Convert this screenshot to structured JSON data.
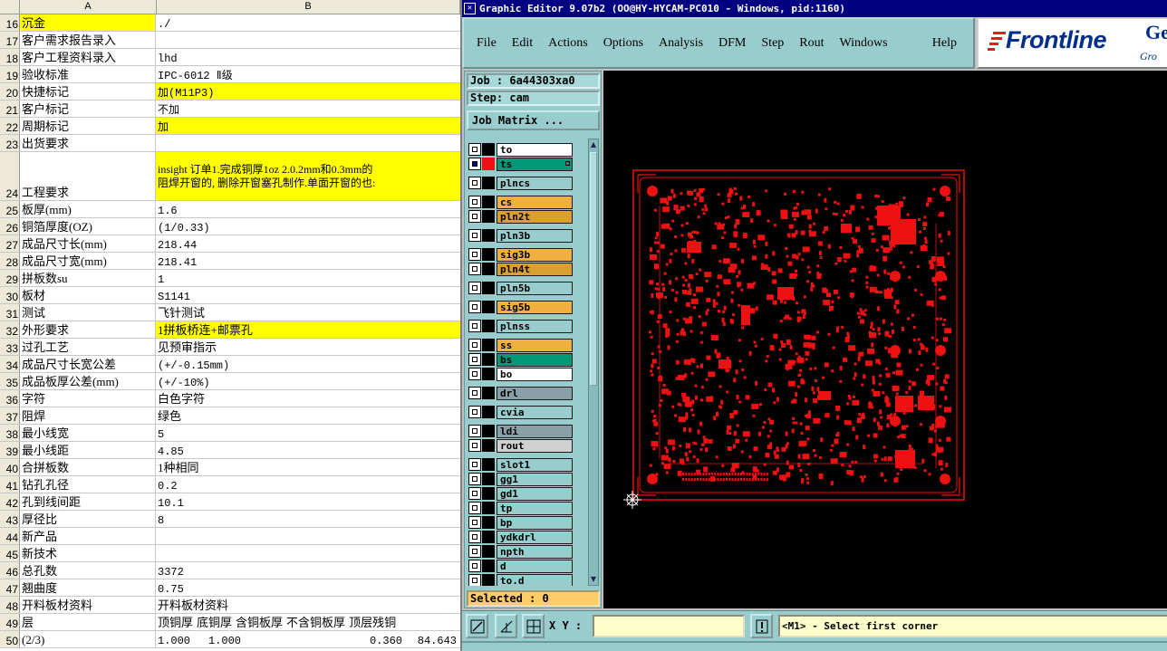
{
  "spreadsheet": {
    "columns": [
      "A",
      "B"
    ],
    "rows": [
      {
        "n": "16",
        "a": "沉金",
        "b": "./",
        "hl": "a",
        "h": 19
      },
      {
        "n": "17",
        "a": "客户需求报告录入",
        "b": "",
        "h": 19
      },
      {
        "n": "18",
        "a": "客户工程资料录入",
        "b": "lhd",
        "h": 19
      },
      {
        "n": "19",
        "a": "验收标准",
        "b": "IPC-6012 Ⅱ级",
        "h": 19
      },
      {
        "n": "20",
        "a": "快捷标记",
        "b": "加(M11P3)",
        "hl": "b",
        "h": 19
      },
      {
        "n": "21",
        "a": "客户标记",
        "b": "不加",
        "h": 19
      },
      {
        "n": "22",
        "a": "周期标记",
        "b": "加",
        "hl": "b",
        "h": 19
      },
      {
        "n": "23",
        "a": "出货要求",
        "b": "",
        "h": 19
      },
      {
        "n": "24",
        "a": "工程要求",
        "b": "insight 订单1.完成铜厚1oz 2.0.2mm和0.3mm的",
        "b2": "阻焊开窗的, 删除开窗塞孔制作.单面开窗的也:",
        "hl": "b",
        "h": 54,
        "wrap": true
      },
      {
        "n": "25",
        "a": "板厚(mm)",
        "b": "1.6",
        "h": 19
      },
      {
        "n": "26",
        "a": "铜箔厚度(OZ)",
        "b": "(1/0.33)",
        "h": 19
      },
      {
        "n": "27",
        "a": "成品尺寸长(mm)",
        "b": "218.44",
        "h": 19
      },
      {
        "n": "28",
        "a": "成品尺寸宽(mm)",
        "b": "218.41",
        "h": 19
      },
      {
        "n": "29",
        "a": "拼板数su",
        "b": "1",
        "h": 19
      },
      {
        "n": "30",
        "a": "板材",
        "b": "S1141",
        "h": 19
      },
      {
        "n": "31",
        "a": "测试",
        "b": "飞针测试",
        "prop": true,
        "h": 19
      },
      {
        "n": "32",
        "a": "外形要求",
        "b": "1拼板桥连+邮票孔",
        "hl": "b",
        "prop": true,
        "h": 19
      },
      {
        "n": "33",
        "a": "过孔工艺",
        "b": "见预审指示",
        "prop": true,
        "h": 19
      },
      {
        "n": "34",
        "a": "成品尺寸长宽公差",
        "b": "(+/-0.15mm)",
        "h": 19
      },
      {
        "n": "35",
        "a": "成品板厚公差(mm)",
        "b": "(+/-10%)",
        "h": 19
      },
      {
        "n": "36",
        "a": "字符",
        "b": "白色字符",
        "prop": true,
        "h": 19
      },
      {
        "n": "37",
        "a": "阻焊",
        "b": "绿色",
        "prop": true,
        "h": 19
      },
      {
        "n": "38",
        "a": "最小线宽",
        "b": "5",
        "h": 19
      },
      {
        "n": "39",
        "a": "最小线距",
        "b": "4.85",
        "h": 19
      },
      {
        "n": "40",
        "a": "合拼板数",
        "b": "1种相同",
        "prop": true,
        "h": 19
      },
      {
        "n": "41",
        "a": "钻孔孔径",
        "b": "0.2",
        "h": 19
      },
      {
        "n": "42",
        "a": "孔到线间距",
        "b": "10.1",
        "h": 19
      },
      {
        "n": "43",
        "a": "厚径比",
        "b": "8",
        "h": 19
      },
      {
        "n": "44",
        "a": "新产品",
        "b": "",
        "h": 19
      },
      {
        "n": "45",
        "a": "新技术",
        "b": "",
        "h": 19
      },
      {
        "n": "46",
        "a": "总孔数",
        "b": "3372",
        "h": 19
      },
      {
        "n": "47",
        "a": "翘曲度",
        "b": "0.75",
        "h": 19
      },
      {
        "n": "48",
        "a": "开料板材资料",
        "b": "开料板材资料",
        "prop": true,
        "h": 19
      },
      {
        "n": "49",
        "a": "层",
        "b_parts": [
          "顶铜厚",
          "底铜厚",
          "含铜板厚",
          "不含铜板厚",
          "顶层残铜"
        ],
        "prop": true,
        "h": 19
      },
      {
        "n": "50",
        "a": "(2/3)",
        "b_parts": [
          "1.000",
          "1.000",
          "0.360",
          "84.643"
        ],
        "h": 19
      }
    ]
  },
  "editor": {
    "title": "Graphic Editor 9.07b2 (OO@HY-HYCAM-PC010 - Windows, pid:1160)",
    "menus": [
      "File",
      "Edit",
      "Actions",
      "Options",
      "Analysis",
      "DFM",
      "Step",
      "Rout",
      "Windows"
    ],
    "help": "Help",
    "logo_text": "Frontline",
    "logo_text2": "Gen",
    "logo_sub": "Gro",
    "job_label": "Job : 6a44303xa0",
    "step_label": "Step: cam",
    "job_matrix_label": "Job Matrix ...",
    "selected_label": "Selected : 0",
    "xy_label": "X Y :",
    "xy_value": "",
    "status_message": "<M1> - Select first corner",
    "layers": [
      {
        "name": "to",
        "color": "#ffffff",
        "gap": false
      },
      {
        "name": "ts",
        "color": "#009977",
        "active": true,
        "gap": false
      },
      {
        "name": "plncs",
        "color": "#99cccc",
        "gap": true
      },
      {
        "name": "cs",
        "color": "#f0b040",
        "gap": true
      },
      {
        "name": "pln2t",
        "color": "#d9a030",
        "gap": false
      },
      {
        "name": "pln3b",
        "color": "#99cccc",
        "gap": true
      },
      {
        "name": "sig3b",
        "color": "#f0b040",
        "gap": true
      },
      {
        "name": "pln4t",
        "color": "#d9a030",
        "gap": false
      },
      {
        "name": "pln5b",
        "color": "#99cccc",
        "gap": true
      },
      {
        "name": "sig5b",
        "color": "#f0b040",
        "gap": true
      },
      {
        "name": "plnss",
        "color": "#99cccc",
        "gap": true
      },
      {
        "name": "ss",
        "color": "#f0b040",
        "gap": true
      },
      {
        "name": "bs",
        "color": "#009977",
        "gap": false
      },
      {
        "name": "bo",
        "color": "#ffffff",
        "gap": false
      },
      {
        "name": "drl",
        "color": "#8aa0a8",
        "gap": true
      },
      {
        "name": "cvia",
        "color": "#99cccc",
        "gap": true
      },
      {
        "name": "ldi",
        "color": "#8aa0a8",
        "gap": true
      },
      {
        "name": "rout",
        "color": "#d0d0d0",
        "gap": false
      },
      {
        "name": "slot1",
        "color": "#99cccc",
        "gap": true
      },
      {
        "name": "gg1",
        "color": "#99cccc",
        "gap": false
      },
      {
        "name": "gd1",
        "color": "#99cccc",
        "gap": false
      },
      {
        "name": "tp",
        "color": "#99cccc",
        "gap": false
      },
      {
        "name": "bp",
        "color": "#99cccc",
        "gap": false
      },
      {
        "name": "ydkdrl",
        "color": "#99cccc",
        "gap": false
      },
      {
        "name": "npth",
        "color": "#99cccc",
        "gap": false
      },
      {
        "name": "d",
        "color": "#99cccc",
        "gap": false
      },
      {
        "name": "to.d",
        "color": "#99cccc",
        "gap": false
      }
    ],
    "colors": {
      "board": "#ee1111",
      "panel": "#99cccc",
      "title_bg": "#000080"
    }
  }
}
